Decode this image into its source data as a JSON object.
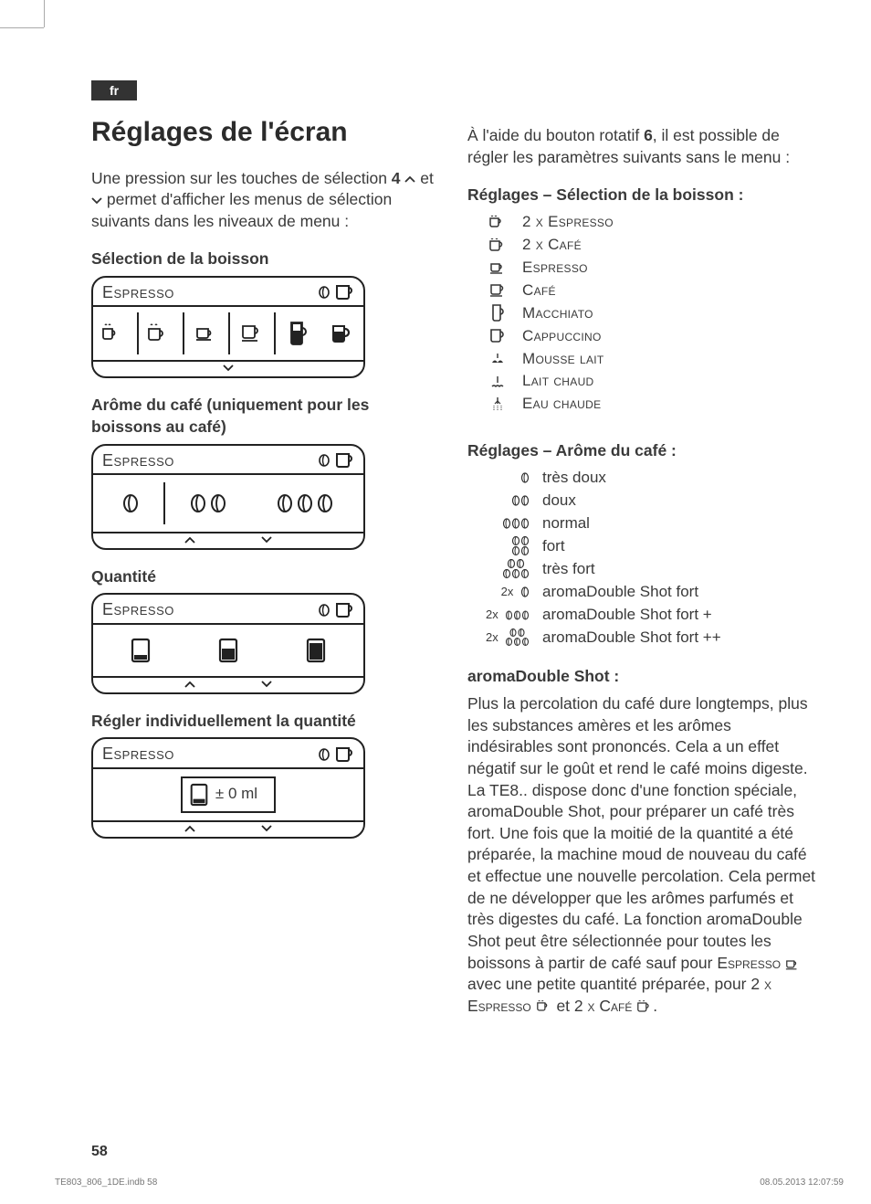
{
  "lang_tag": "fr",
  "title": "Réglages de l'écran",
  "intro": {
    "line1_a": "Une pression sur les touches de sélection ",
    "bold4": "4",
    "line1_b": " et ",
    "line1_c": " permet d'afficher les menus de sélection suivants dans les niveaux de menu :"
  },
  "headings": {
    "h1": "Sélection de la boisson",
    "h2": "Arôme du café (uniquement pour les boissons au café)",
    "h3": "Quantité",
    "h4": "Régler individuellement la quantité"
  },
  "panel_label": "Espresso",
  "panel4_value": "± 0 ml",
  "right_intro_a": "À l'aide du bouton rotatif ",
  "right_intro_bold": "6",
  "right_intro_b": ", il est possible de régler les paramètres suivants sans le menu :",
  "drink_heading": "Réglages – Sélection de la boisson :",
  "drinks": [
    "2 x Espresso",
    "2 x Café",
    "Espresso",
    "Café",
    "Macchiato",
    "Cappuccino",
    "Mousse lait",
    "Lait chaud",
    "Eau chaude"
  ],
  "aroma_heading": "Réglages – Arôme du café :",
  "aromas": [
    {
      "pre": "",
      "label": "très doux"
    },
    {
      "pre": "",
      "label": "doux"
    },
    {
      "pre": "",
      "label": "normal"
    },
    {
      "pre": "",
      "label": "fort"
    },
    {
      "pre": "",
      "label": "très fort"
    },
    {
      "pre": "2x",
      "label": "aromaDouble Shot fort"
    },
    {
      "pre": "2x",
      "label": "aromaDouble Shot fort +"
    },
    {
      "pre": "2x",
      "label": "aromaDouble Shot fort ++"
    }
  ],
  "ads_heading": "aromaDouble Shot :",
  "ads_body_1": "Plus la percolation du café dure longtemps, plus les substances amères et les arômes indésirables sont prononcés. Cela a un effet négatif sur le goût et rend le café moins digeste. La TE8.. dispose donc d'une fonction spéciale, aromaDouble Shot, pour préparer un café très fort. Une fois que la moitié de la quantité a été préparée, la machine moud de nouveau du café et effectue une nouvelle percolation. Cela permet de ne développer que les arômes parfumés et très digestes du café. La fonction aromaDouble Shot peut être sélectionnée pour toutes les boissons à partir de café sauf pour ",
  "ads_esp": "Espresso",
  "ads_body_2": " avec une petite quantité préparée, pour ",
  "ads_2esp": "2 x Espresso",
  "ads_body_3": " et ",
  "ads_2cafe": "2 x Café",
  "ads_body_4": ".",
  "page_number": "58",
  "print_file": "TE803_806_1DE.indb   58",
  "print_date": "08.05.2013   12:07:59"
}
